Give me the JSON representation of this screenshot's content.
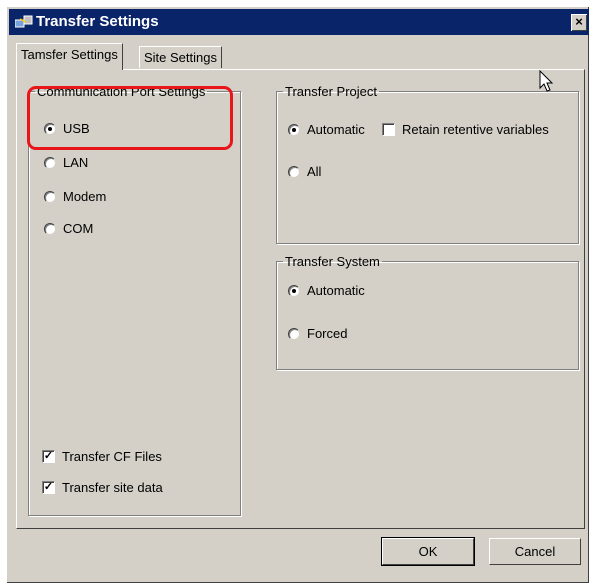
{
  "window": {
    "title": "Transfer Settings",
    "close_glyph": "×"
  },
  "tabs": [
    {
      "label": "Tamsfer Settings",
      "active": true
    },
    {
      "label": "Site Settings",
      "active": false
    }
  ],
  "comm_port": {
    "legend": "Communication Port Settings",
    "options": [
      {
        "label": "USB",
        "selected": true
      },
      {
        "label": "LAN",
        "selected": false
      },
      {
        "label": "Modem",
        "selected": false
      },
      {
        "label": "COM",
        "selected": false
      }
    ]
  },
  "transfer_project": {
    "legend": "Transfer Project",
    "automatic_label": "Automatic",
    "retain_label": "Retain retentive variables",
    "all_label": "All"
  },
  "transfer_system": {
    "legend": "Transfer System",
    "automatic_label": "Automatic",
    "forced_label": "Forced"
  },
  "checkboxes": {
    "cf_files_label": "Transfer CF Files",
    "site_data_label": "Transfer site data",
    "check_glyph": "✓"
  },
  "buttons": {
    "ok_label": "OK",
    "cancel_label": "Cancel"
  },
  "colors": {
    "titlebar": "#0a246a",
    "highlight": "#e8161b",
    "face": "#d4d0c8"
  }
}
